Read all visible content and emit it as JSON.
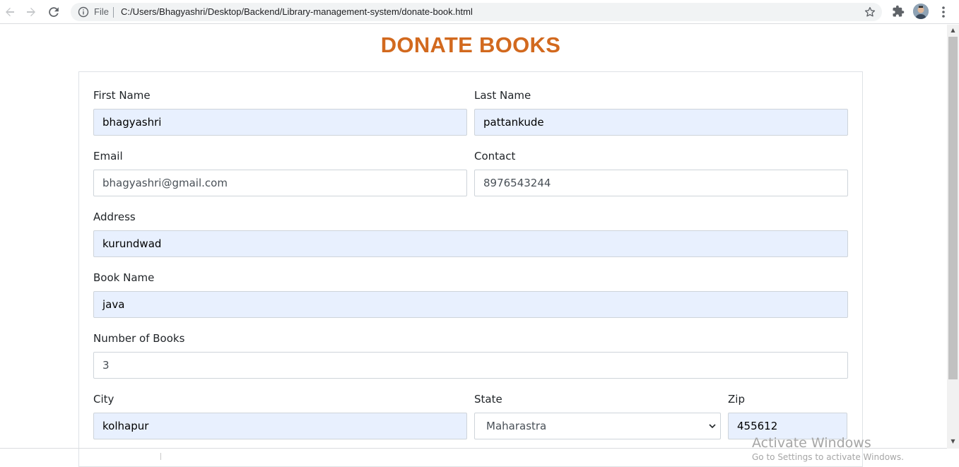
{
  "browser": {
    "scheme_label": "File",
    "url": "C:/Users/Bhagyashri/Desktop/Backend/Library-management-system/donate-book.html"
  },
  "page": {
    "title": "DONATE BOOKS",
    "title_color": "#d2691e"
  },
  "form": {
    "first_name": {
      "label": "First Name",
      "value": "bhagyashri"
    },
    "last_name": {
      "label": "Last Name",
      "value": "pattankude"
    },
    "email": {
      "label": "Email",
      "value": "bhagyashri@gmail.com"
    },
    "contact": {
      "label": "Contact",
      "value": "8976543244"
    },
    "address": {
      "label": "Address",
      "value": "kurundwad"
    },
    "book_name": {
      "label": "Book Name",
      "value": "java"
    },
    "number_of_books": {
      "label": "Number of Books",
      "value": "3"
    },
    "city": {
      "label": "City",
      "value": "kolhapur"
    },
    "state": {
      "label": "State",
      "value": "Maharastra"
    },
    "zip": {
      "label": "Zip",
      "value": "455612"
    }
  },
  "watermark": {
    "line1": "Activate Windows",
    "line2": "Go to Settings to activate Windows."
  },
  "icons": {
    "back": "arrow-left-icon",
    "forward": "arrow-right-icon",
    "reload": "reload-icon",
    "info": "info-icon",
    "bookmark": "star-icon",
    "extensions": "puzzle-icon",
    "menu": "kebab-menu-icon"
  }
}
